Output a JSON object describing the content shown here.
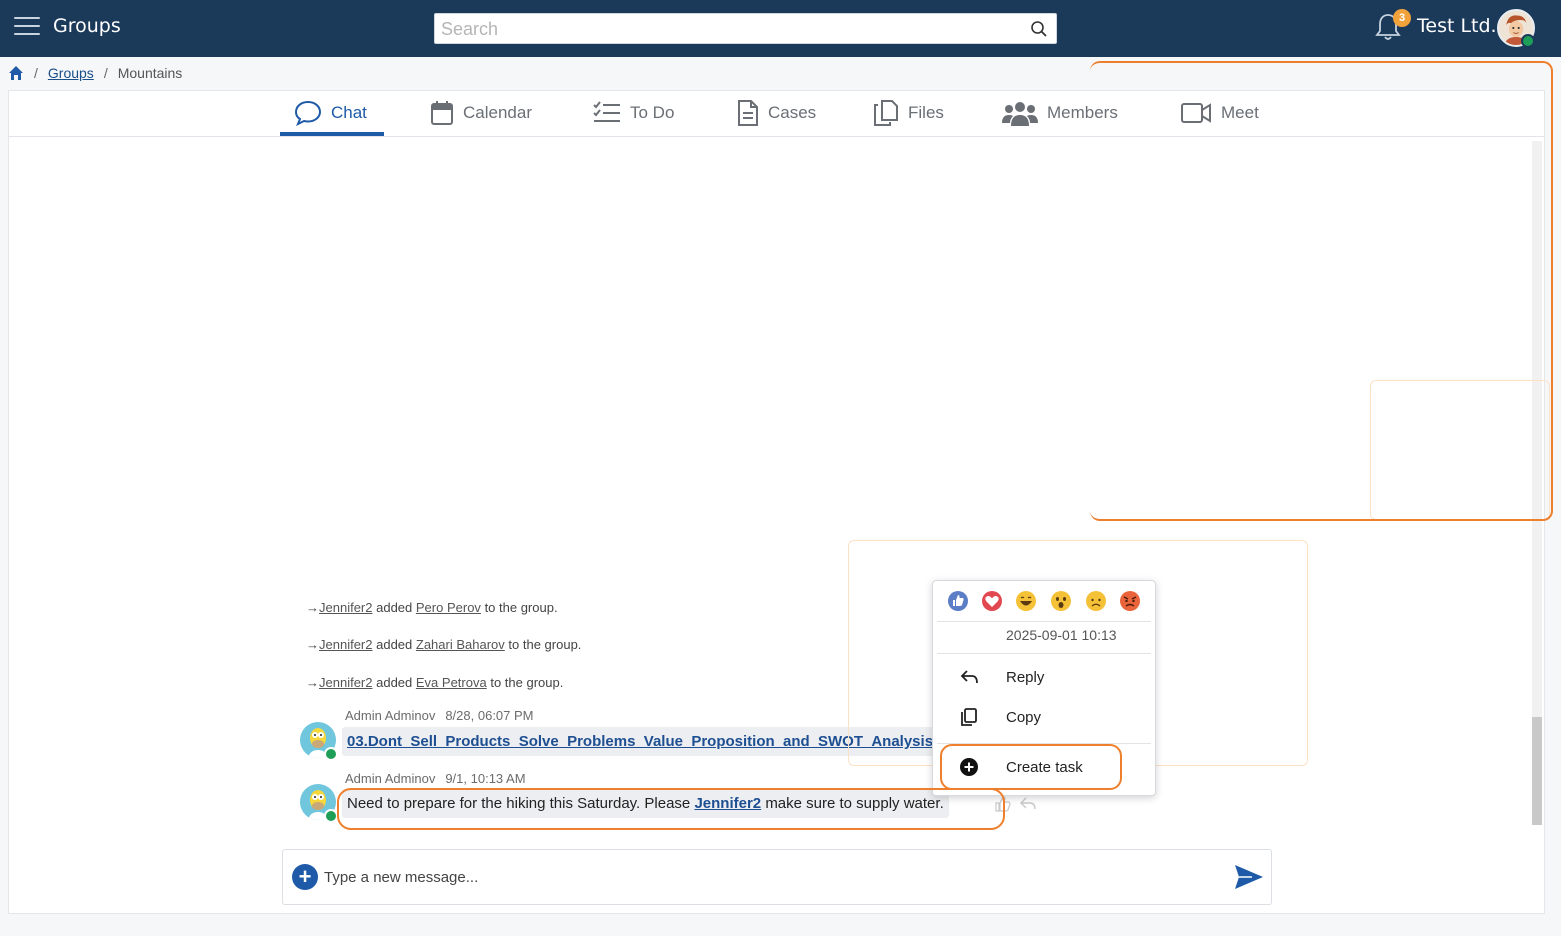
{
  "app": {
    "title": "Groups"
  },
  "search": {
    "placeholder": "Search"
  },
  "notifications": {
    "count": "3"
  },
  "org": {
    "name": "Test Ltd."
  },
  "breadcrumb": {
    "groups": "Groups",
    "current": "Mountains"
  },
  "tabs": {
    "chat": "Chat",
    "calendar": "Calendar",
    "todo": "To Do",
    "cases": "Cases",
    "files": "Files",
    "members": "Members",
    "meet": "Meet"
  },
  "system_messages": [
    {
      "actor": "Jennifer2",
      "verb": "added",
      "target": "Pero Perov",
      "suffix": "to the group."
    },
    {
      "actor": "Jennifer2",
      "verb": "added",
      "target": "Zahari Baharov",
      "suffix": "to the group."
    },
    {
      "actor": "Jennifer2",
      "verb": "added",
      "target": "Eva Petrova",
      "suffix": "to the group."
    }
  ],
  "messages": [
    {
      "author": "Admin Adminov",
      "time": "8/28, 06:07 PM",
      "file": "03.Dont_Sell_Products_Solve_Problems_Value_Proposition_and_SWOT_Analysis"
    },
    {
      "author": "Admin Adminov",
      "time": "9/1, 10:13 AM",
      "text_before": "Need to prepare for the hiking this Saturday. Please",
      "mention": "Jennifer2",
      "text_after": "make sure to supply water."
    }
  ],
  "composer": {
    "placeholder": "Type a new message..."
  },
  "context_menu": {
    "reactions": [
      "like-icon",
      "heart-icon",
      "laugh-icon",
      "wow-icon",
      "sad-icon",
      "angry-icon"
    ],
    "timestamp": "2025-09-01 10:13",
    "reply": "Reply",
    "copy": "Copy",
    "create_task": "Create task"
  },
  "colors": {
    "topbar": "#1b3a5a",
    "accent": "#1e5aa8",
    "annotation": "#ee7f2d",
    "badge": "#f2a23a",
    "online": "#1e9e57"
  }
}
